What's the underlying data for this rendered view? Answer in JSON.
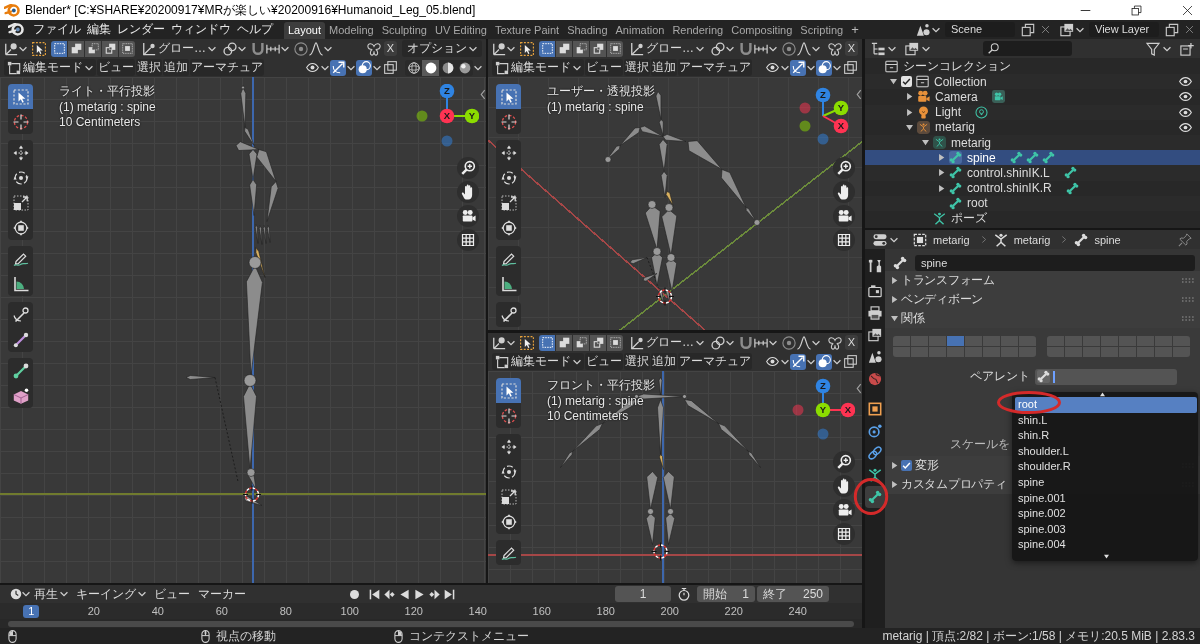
{
  "window": {
    "title": "Blender* [C:¥SHARE¥20200917¥MRが楽しい¥20200916¥Humanoid_Leg_05.blend]"
  },
  "top_bar": {
    "menus": [
      "ファイル",
      "編集",
      "レンダー",
      "ウィンドウ",
      "ヘルプ"
    ],
    "workspace_tabs": [
      {
        "label": "Layout",
        "selected": true
      },
      {
        "label": "Modeling",
        "selected": false
      },
      {
        "label": "Sculpting",
        "selected": false
      },
      {
        "label": "UV Editing",
        "selected": false
      },
      {
        "label": "Texture Paint",
        "selected": false
      },
      {
        "label": "Shading",
        "selected": false
      },
      {
        "label": "Animation",
        "selected": false
      },
      {
        "label": "Rendering",
        "selected": false
      },
      {
        "label": "Compositing",
        "selected": false
      },
      {
        "label": "Scripting",
        "selected": false
      }
    ],
    "add_tab": "+",
    "scene": "Scene",
    "view_layer": "View Layer"
  },
  "viewports": [
    {
      "kind": "side",
      "header": {
        "select_modes": [
          {
            "selected": true
          },
          {
            "selected": false
          },
          {
            "selected": false
          },
          {
            "selected": false
          },
          {
            "selected": false
          }
        ],
        "orientation": "グロー…",
        "mirror_axis": "X",
        "options": "オプション",
        "mode": "編集モード",
        "menus": [
          "ビュー",
          "選択",
          "追加",
          "アーマチュア"
        ],
        "toggles": [
          {
            "kind": "visibility",
            "on": false
          },
          {
            "kind": "gizmo",
            "on": true
          },
          {
            "kind": "overlay",
            "on": true
          },
          {
            "kind": "xray",
            "on": false
          }
        ],
        "shading_modes": [
          {
            "selected": false
          },
          {
            "selected": true
          },
          {
            "selected": false
          },
          {
            "selected": false
          }
        ]
      },
      "overlay_text": [
        "ライト・平行投影",
        "(1) metarig : spine",
        "10 Centimeters"
      ],
      "axes": [
        {
          "label": "Z",
          "color": "#2f84e3"
        },
        {
          "label": "Y",
          "color": "#8bdc00"
        },
        {
          "label": "X",
          "color": "#ff3352"
        }
      ],
      "tool_groups": [
        [
          {
            "kind": "select",
            "selected": true
          },
          {
            "kind": "cursor",
            "selected": false
          }
        ],
        [
          {
            "kind": "move",
            "selected": false
          },
          {
            "kind": "rotate",
            "selected": false
          },
          {
            "kind": "scale",
            "selected": false
          },
          {
            "kind": "transform",
            "selected": false
          }
        ],
        [
          {
            "kind": "annotate",
            "selected": false
          },
          {
            "kind": "measure",
            "selected": false
          }
        ],
        [
          {
            "kind": "roll",
            "selected": false
          },
          {
            "kind": "bone_size",
            "selected": false
          }
        ],
        [
          {
            "kind": "extrude",
            "selected": false
          },
          {
            "kind": "envelope",
            "selected": false
          }
        ]
      ]
    },
    {
      "kind": "perspective",
      "header": {
        "select_modes": [
          {
            "selected": true
          },
          {
            "selected": false
          },
          {
            "selected": false
          },
          {
            "selected": false
          },
          {
            "selected": false
          }
        ],
        "orientation": "グロー…",
        "mirror_axis": "X",
        "mode": "編集モード",
        "menus": [
          "ビュー",
          "選択",
          "追加",
          "アーマチュア"
        ],
        "toggles": [
          {
            "kind": "visibility",
            "on": false
          },
          {
            "kind": "gizmo",
            "on": true
          },
          {
            "kind": "overlay",
            "on": true
          },
          {
            "kind": "xray",
            "on": false
          }
        ]
      },
      "overlay_text": [
        "ユーザー・透視投影",
        "(1) metarig : spine"
      ],
      "axes": [
        {
          "label": "Z",
          "color": "#2f84e3"
        },
        {
          "label": "Y",
          "color": "#8bdc00"
        },
        {
          "label": "X",
          "color": "#ff3352"
        }
      ],
      "tool_groups": [
        [
          {
            "kind": "select",
            "selected": true
          },
          {
            "kind": "cursor",
            "selected": false
          }
        ],
        [
          {
            "kind": "move",
            "selected": false
          },
          {
            "kind": "rotate",
            "selected": false
          },
          {
            "kind": "scale",
            "selected": false
          },
          {
            "kind": "transform",
            "selected": false
          }
        ],
        [
          {
            "kind": "annotate",
            "selected": false
          },
          {
            "kind": "measure",
            "selected": false
          }
        ],
        [
          {
            "kind": "roll",
            "selected": false
          }
        ]
      ]
    },
    {
      "kind": "front",
      "header": {
        "select_modes": [
          {
            "selected": true
          },
          {
            "selected": false
          },
          {
            "selected": false
          },
          {
            "selected": false
          },
          {
            "selected": false
          }
        ],
        "orientation": "グロー…",
        "mirror_axis": "X",
        "mode": "編集モード",
        "menus": [
          "ビュー",
          "選択",
          "追加",
          "アーマチュア"
        ],
        "toggles": [
          {
            "kind": "visibility",
            "on": false
          },
          {
            "kind": "gizmo",
            "on": true
          },
          {
            "kind": "overlay",
            "on": true
          },
          {
            "kind": "xray",
            "on": false
          }
        ]
      },
      "overlay_text": [
        "フロント・平行投影",
        "(1) metarig : spine",
        "10 Centimeters"
      ],
      "axes": [
        {
          "label": "Z",
          "color": "#2f84e3"
        },
        {
          "label": "Y",
          "color": "#8bdc00"
        },
        {
          "label": "X",
          "color": "#ff3352"
        }
      ],
      "tool_groups": [
        [
          {
            "kind": "select",
            "selected": true
          },
          {
            "kind": "cursor",
            "selected": false
          }
        ],
        [
          {
            "kind": "move",
            "selected": false
          },
          {
            "kind": "rotate",
            "selected": false
          },
          {
            "kind": "scale",
            "selected": false
          },
          {
            "kind": "transform",
            "selected": false
          }
        ],
        [
          {
            "kind": "annotate",
            "selected": false
          }
        ]
      ]
    }
  ],
  "outliner": {
    "tree": [
      {
        "label": "シーンコレクション",
        "kind": "scene_collection",
        "selected": false,
        "children": [
          {
            "label": "Collection",
            "kind": "collection",
            "selected": false,
            "expanded": true,
            "checked": true,
            "visible": true,
            "children": [
              {
                "label": "Camera",
                "kind": "camera",
                "selected": false,
                "expanded": false,
                "visible": true,
                "extras": [
                  {
                    "kind": "camera_data"
                  }
                ]
              },
              {
                "label": "Light",
                "kind": "light",
                "selected": false,
                "expanded": false,
                "visible": true,
                "extras": [
                  {
                    "kind": "light_data"
                  }
                ]
              },
              {
                "label": "metarig",
                "kind": "armature_object",
                "selected": false,
                "expanded": true,
                "visible": true,
                "children": [
                  {
                    "label": "metarig",
                    "kind": "armature_data",
                    "selected": false,
                    "expanded": true,
                    "children": [
                      {
                        "label": "spine",
                        "kind": "bone",
                        "selected": true,
                        "expanded": false,
                        "extras": [
                          {
                            "kind": "bone"
                          },
                          {
                            "kind": "bone"
                          },
                          {
                            "kind": "bone"
                          }
                        ]
                      },
                      {
                        "label": "control.shinIK.L",
                        "kind": "bone",
                        "selected": false,
                        "expanded": false,
                        "extras": [
                          {
                            "kind": "bone"
                          }
                        ]
                      },
                      {
                        "label": "control.shinIK.R",
                        "kind": "bone",
                        "selected": false,
                        "expanded": false,
                        "extras": [
                          {
                            "kind": "bone"
                          }
                        ]
                      },
                      {
                        "label": "root",
                        "kind": "bone",
                        "selected": false
                      }
                    ]
                  },
                  {
                    "label": "ポーズ",
                    "kind": "pose",
                    "selected": false
                  }
                ]
              }
            ]
          }
        ]
      }
    ]
  },
  "properties": {
    "breadcrumbs": [
      {
        "kind": "object",
        "label": "metarig"
      },
      {
        "kind": "armature",
        "label": "metarig"
      },
      {
        "kind": "bone",
        "label": "spine"
      }
    ],
    "tab_groups": [
      [
        {
          "kind": "tool",
          "selected": false,
          "circled": false
        }
      ],
      [
        {
          "kind": "render",
          "selected": false,
          "circled": false
        },
        {
          "kind": "output",
          "selected": false,
          "circled": false
        },
        {
          "kind": "view_layer",
          "selected": false,
          "circled": false
        },
        {
          "kind": "scene",
          "selected": false,
          "circled": false
        },
        {
          "kind": "world",
          "selected": false,
          "circled": false
        }
      ],
      [
        {
          "kind": "object",
          "selected": false,
          "circled": false
        },
        {
          "kind": "physics",
          "selected": false,
          "circled": false
        },
        {
          "kind": "constraints",
          "selected": false,
          "circled": false
        },
        {
          "kind": "armature",
          "selected": false,
          "circled": false
        },
        {
          "kind": "bone",
          "selected": true,
          "circled": true
        }
      ]
    ],
    "name": "spine",
    "panels": [
      {
        "kind": "plain",
        "title": "トランスフォーム",
        "expanded": false
      },
      {
        "kind": "plain",
        "title": "ベンディボーン",
        "expanded": false
      },
      {
        "kind": "relations",
        "title": "関係",
        "expanded": true,
        "layer_blocks": [
          [
            {
              "selected": false
            },
            {
              "selected": false
            },
            {
              "selected": false
            },
            {
              "selected": true
            },
            {
              "selected": false
            },
            {
              "selected": false
            },
            {
              "selected": false
            },
            {
              "selected": false
            },
            {
              "selected": false
            },
            {
              "selected": false
            },
            {
              "selected": false
            },
            {
              "selected": false
            },
            {
              "selected": false
            },
            {
              "selected": false
            },
            {
              "selected": false
            },
            {
              "selected": false
            }
          ],
          [
            {
              "selected": false
            },
            {
              "selected": false
            },
            {
              "selected": false
            },
            {
              "selected": false
            },
            {
              "selected": false
            },
            {
              "selected": false
            },
            {
              "selected": false
            },
            {
              "selected": false
            },
            {
              "selected": false
            },
            {
              "selected": false
            },
            {
              "selected": false
            },
            {
              "selected": false
            },
            {
              "selected": false
            },
            {
              "selected": false
            },
            {
              "selected": false
            },
            {
              "selected": false
            }
          ]
        ],
        "parent_label": "ペアレント",
        "inherit_scale_label": "スケールを"
      },
      {
        "kind": "checkbox",
        "title": "変形",
        "expanded": false,
        "checked": true
      },
      {
        "kind": "plain",
        "title": "カスタムプロパティ",
        "expanded": false
      }
    ],
    "parent_menu": {
      "items": [
        {
          "label": "root",
          "selected": true,
          "circled": true
        },
        {
          "label": "shin.L",
          "selected": false,
          "circled": false
        },
        {
          "label": "shin.R",
          "selected": false,
          "circled": false
        },
        {
          "label": "shoulder.L",
          "selected": false,
          "circled": false
        },
        {
          "label": "shoulder.R",
          "selected": false,
          "circled": false
        },
        {
          "label": "spine",
          "selected": false,
          "circled": false
        },
        {
          "label": "spine.001",
          "selected": false,
          "circled": false
        },
        {
          "label": "spine.002",
          "selected": false,
          "circled": false
        },
        {
          "label": "spine.003",
          "selected": false,
          "circled": false
        },
        {
          "label": "spine.004",
          "selected": false,
          "circled": false
        }
      ]
    }
  },
  "timeline": {
    "menus": [
      {
        "label": "再生",
        "dropdown": true
      },
      {
        "label": "キーイング",
        "dropdown": true
      },
      {
        "label": "ビュー",
        "dropdown": false
      },
      {
        "label": "マーカー",
        "dropdown": false
      }
    ],
    "current_frame": "1",
    "start": {
      "label": "開始",
      "value": "1"
    },
    "end": {
      "label": "終了",
      "value": "250"
    },
    "ruler_current": "1",
    "ruler_ticks": [
      "20",
      "40",
      "60",
      "80",
      "100",
      "120",
      "140",
      "160",
      "180",
      "200",
      "220",
      "240"
    ]
  },
  "status_bar": {
    "hints": [
      "視点の移動",
      "コンテクストメニュー"
    ],
    "stats": "metarig | 頂点:2/82 | ボーン:1/58 | メモリ:20.5 MiB | 2.83.3"
  }
}
